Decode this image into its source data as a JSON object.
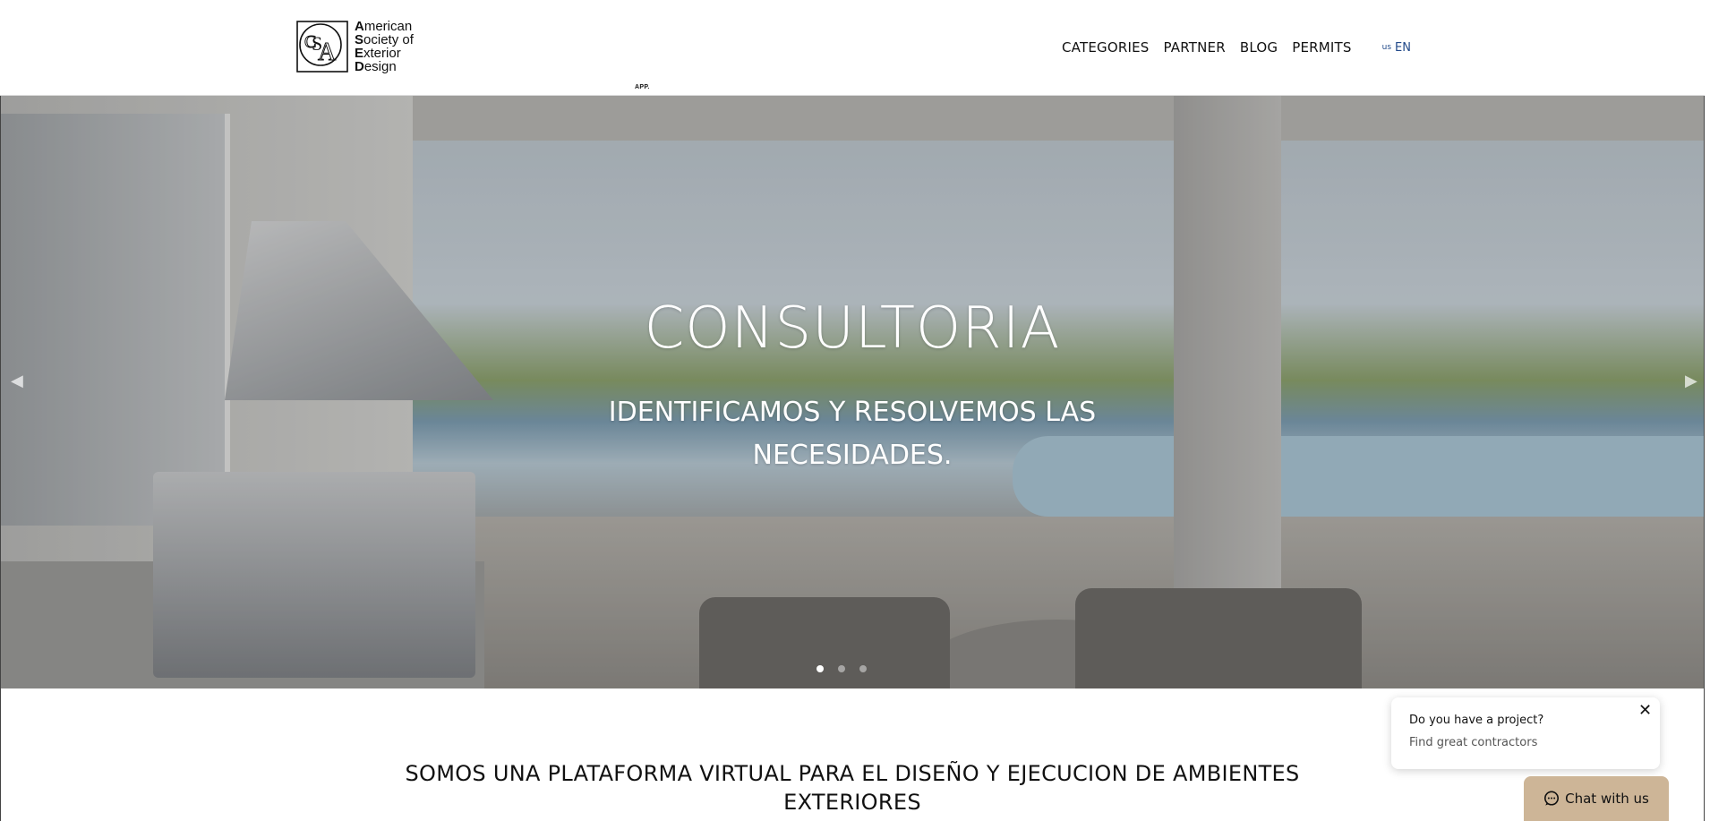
{
  "logo": {
    "lines": [
      "American",
      "Society of",
      "Exterior",
      "Design"
    ],
    "tag": "APP."
  },
  "nav": {
    "items": [
      "CATEGORIES",
      "PARTNER",
      "BLOG",
      "PERMITS"
    ],
    "lang_flag": "us",
    "lang": "EN"
  },
  "hero": {
    "title": "CONSULTORIA",
    "subtitle": "IDENTIFICAMOS Y RESOLVEMOS LAS NECESIDADES.",
    "slides": 3,
    "active_slide": 1
  },
  "section": {
    "title": "SOMOS UNA PLATAFORMA VIRTUAL PARA EL DISEÑO Y EJECUCION DE AMBIENTES EXTERIORES"
  },
  "popup": {
    "question": "Do you have a project?",
    "subtext": "Find great contractors",
    "close_icon": "✕"
  },
  "chat": {
    "label": "Chat with us",
    "color": "#cdb597"
  },
  "icons": {
    "prev": "◀",
    "next": "▶"
  }
}
